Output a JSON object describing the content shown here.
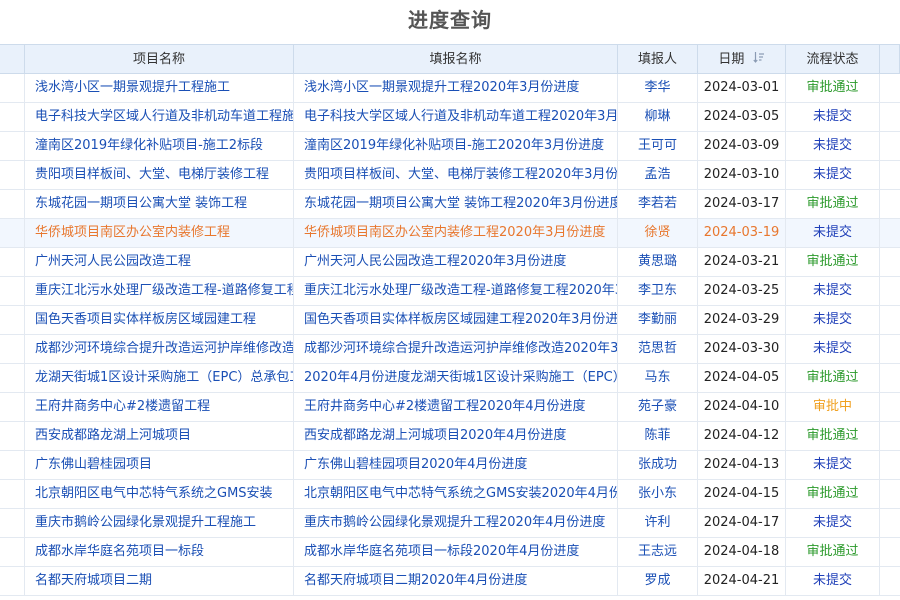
{
  "page": {
    "title": "进度查询"
  },
  "table": {
    "headers": {
      "project": "项目名称",
      "report": "填报名称",
      "reporter": "填报人",
      "date": "日期",
      "status": "流程状态"
    },
    "status_colors": {
      "审批通过": "#2c9a2c",
      "未提交": "#1f3fb8",
      "审批中": "#f0a020"
    },
    "selected_row_index": 5,
    "rows": [
      {
        "project": "浅水湾小区一期景观提升工程施工",
        "report": "浅水湾小区一期景观提升工程2020年3月份进度",
        "reporter": "李华",
        "date": "2024-03-01",
        "status": "审批通过"
      },
      {
        "project": "电子科技大学区域人行道及非机动车道工程施",
        "report": "电子科技大学区域人行道及非机动车道工程2020年3月份",
        "reporter": "柳琳",
        "date": "2024-03-05",
        "status": "未提交"
      },
      {
        "project": "潼南区2019年绿化补贴项目-施工2标段",
        "report": "潼南区2019年绿化补贴项目-施工2020年3月份进度",
        "reporter": "王可可",
        "date": "2024-03-09",
        "status": "未提交"
      },
      {
        "project": "贵阳项目样板间、大堂、电梯厅装修工程",
        "report": "贵阳项目样板间、大堂、电梯厅装修工程2020年3月份",
        "reporter": "孟浩",
        "date": "2024-03-10",
        "status": "未提交"
      },
      {
        "project": "东城花园一期项目公寓大堂 装饰工程",
        "report": "东城花园一期项目公寓大堂 装饰工程2020年3月份进度",
        "reporter": "李若若",
        "date": "2024-03-17",
        "status": "审批通过"
      },
      {
        "project": "华侨城项目南区办公室内装修工程",
        "report": "华侨城项目南区办公室内装修工程2020年3月份进度",
        "reporter": "徐贤",
        "date": "2024-03-19",
        "status": "未提交"
      },
      {
        "project": "广州天河人民公园改造工程",
        "report": "广州天河人民公园改造工程2020年3月份进度",
        "reporter": "黄思璐",
        "date": "2024-03-21",
        "status": "审批通过"
      },
      {
        "project": "重庆江北污水处理厂级改造工程-道路修复工程",
        "report": "重庆江北污水处理厂级改造工程-道路修复工程2020年3月",
        "reporter": "李卫东",
        "date": "2024-03-25",
        "status": "未提交"
      },
      {
        "project": "国色天香项目实体样板房区域园建工程",
        "report": "国色天香项目实体样板房区域园建工程2020年3月份进",
        "reporter": "李勤丽",
        "date": "2024-03-29",
        "status": "未提交"
      },
      {
        "project": "成都沙河环境综合提升改造运河护岸维修改造",
        "report": "成都沙河环境综合提升改造运河护岸维修改造2020年3月",
        "reporter": "范思哲",
        "date": "2024-03-30",
        "status": "未提交"
      },
      {
        "project": "龙湖天街城1区设计采购施工（EPC）总承包工",
        "report": "2020年4月份进度龙湖天街城1区设计采购施工（EPC）",
        "reporter": "马东",
        "date": "2024-04-05",
        "status": "审批通过"
      },
      {
        "project": "王府井商务中心#2楼遗留工程",
        "report": "王府井商务中心#2楼遗留工程2020年4月份进度",
        "reporter": "苑子豪",
        "date": "2024-04-10",
        "status": "审批中"
      },
      {
        "project": "西安成都路龙湖上河城项目",
        "report": "西安成都路龙湖上河城项目2020年4月份进度",
        "reporter": "陈菲",
        "date": "2024-04-12",
        "status": "审批通过"
      },
      {
        "project": "广东佛山碧桂园项目",
        "report": "广东佛山碧桂园项目2020年4月份进度",
        "reporter": "张成功",
        "date": "2024-04-13",
        "status": "未提交"
      },
      {
        "project": "北京朝阳区电气中芯特气系统之GMS安装",
        "report": "北京朝阳区电气中芯特气系统之GMS安装2020年4月份",
        "reporter": "张小东",
        "date": "2024-04-15",
        "status": "审批通过"
      },
      {
        "project": "重庆市鹅岭公园绿化景观提升工程施工",
        "report": "重庆市鹅岭公园绿化景观提升工程2020年4月份进度",
        "reporter": "许利",
        "date": "2024-04-17",
        "status": "未提交"
      },
      {
        "project": "成都水岸华庭名苑项目一标段",
        "report": "成都水岸华庭名苑项目一标段2020年4月份进度",
        "reporter": "王志远",
        "date": "2024-04-18",
        "status": "审批通过"
      },
      {
        "project": "名都天府城项目二期",
        "report": "名都天府城项目二期2020年4月份进度",
        "reporter": "罗成",
        "date": "2024-04-21",
        "status": "未提交"
      }
    ]
  }
}
